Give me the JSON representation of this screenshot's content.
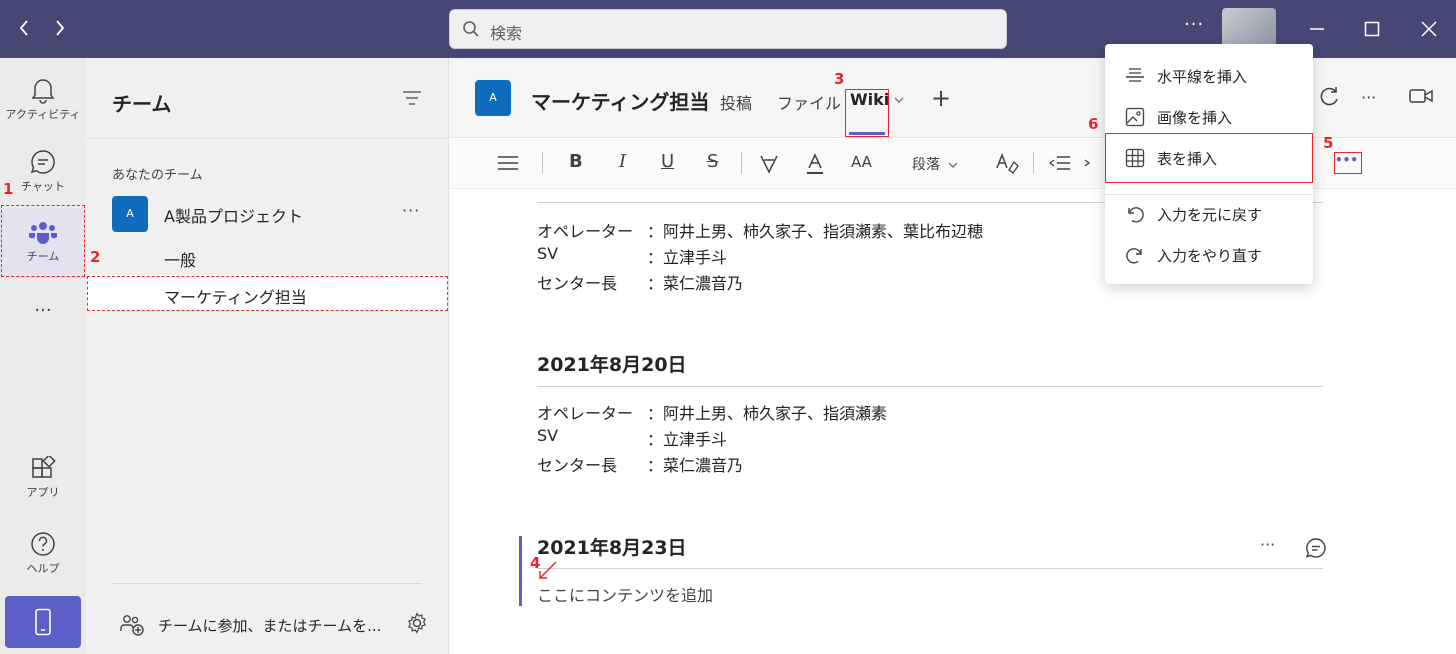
{
  "titlebar": {
    "back_icon": "chevron-left-icon",
    "forward_icon": "chevron-right-icon",
    "search_placeholder": "検索",
    "more": "···"
  },
  "appbar": {
    "items": [
      {
        "label": "アクティビティ",
        "icon": "bell-icon"
      },
      {
        "label": "チャット",
        "icon": "chat-icon"
      },
      {
        "label": "チーム",
        "icon": "teams-icon"
      },
      {
        "label": "アプリ",
        "icon": "apps-icon"
      },
      {
        "label": "ヘルプ",
        "icon": "help-icon"
      }
    ],
    "more": "···"
  },
  "teamlist": {
    "title": "チーム",
    "section_label": "あなたのチーム",
    "team": {
      "avatar": "A",
      "name": "A製品プロジェクト",
      "more": "···"
    },
    "channels": [
      "一般",
      "マーケティング担当"
    ],
    "join_text": "チームに参加、またはチームを..."
  },
  "main": {
    "channel_avatar": "A",
    "channel_title": "マーケティング担当",
    "tabs": [
      {
        "label": "投稿"
      },
      {
        "label": "ファイル"
      },
      {
        "label": "Wiki"
      }
    ],
    "tab_add": "+",
    "more": "···"
  },
  "toolbar": {
    "bold": "B",
    "italic": "I",
    "underline": "U",
    "strike": "S",
    "font_size": "AA",
    "paragraph": "段落",
    "paragraph_chevron": "⌵",
    "more": "•••"
  },
  "content": {
    "block1": [
      {
        "label": "オペレーター",
        "value": "：阿井上男、柿久家子、指須瀬素、葉比布辺穂"
      },
      {
        "label": "SV",
        "value": "：立津手斗"
      },
      {
        "label": "センター長",
        "value": "：菜仁濃音乃"
      }
    ],
    "heading2": "2021年8月20日",
    "block2": [
      {
        "label": "オペレーター",
        "value": "：阿井上男、柿久家子、指須瀬素"
      },
      {
        "label": "SV",
        "value": "：立津手斗"
      },
      {
        "label": "センター長",
        "value": "：菜仁濃音乃"
      }
    ],
    "heading3": "2021年8月23日",
    "placeholder": "ここにコンテンツを追加",
    "section_more": "···"
  },
  "menu": {
    "items": [
      {
        "label": "水平線を挿入",
        "icon": "horizontal-line-icon"
      },
      {
        "label": "画像を挿入",
        "icon": "image-icon"
      },
      {
        "label": "表を挿入",
        "icon": "table-icon"
      },
      {
        "label": "入力を元に戻す",
        "icon": "undo-icon"
      },
      {
        "label": "入力をやり直す",
        "icon": "redo-icon"
      }
    ]
  },
  "annotations": [
    "1",
    "2",
    "3",
    "4",
    "5",
    "6"
  ],
  "colors": {
    "titlebar": "#464775",
    "accent": "#5b5fc7",
    "annotation": "#e8262b",
    "avatar_blue": "#0f6cbd"
  }
}
